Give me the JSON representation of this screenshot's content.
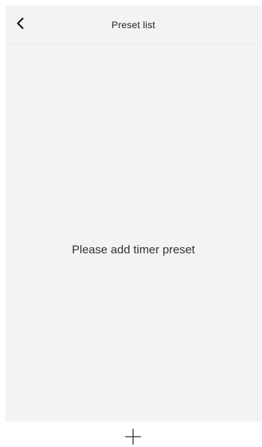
{
  "header": {
    "title": "Preset list",
    "back_icon": "chevron-left-icon"
  },
  "main": {
    "empty_message": "Please add timer preset"
  },
  "footer": {
    "add_icon": "plus-icon"
  },
  "colors": {
    "panel_background": "#f3f3f3",
    "page_background": "#ffffff",
    "text_primary": "#1f1f1f",
    "text_secondary": "#333333"
  }
}
